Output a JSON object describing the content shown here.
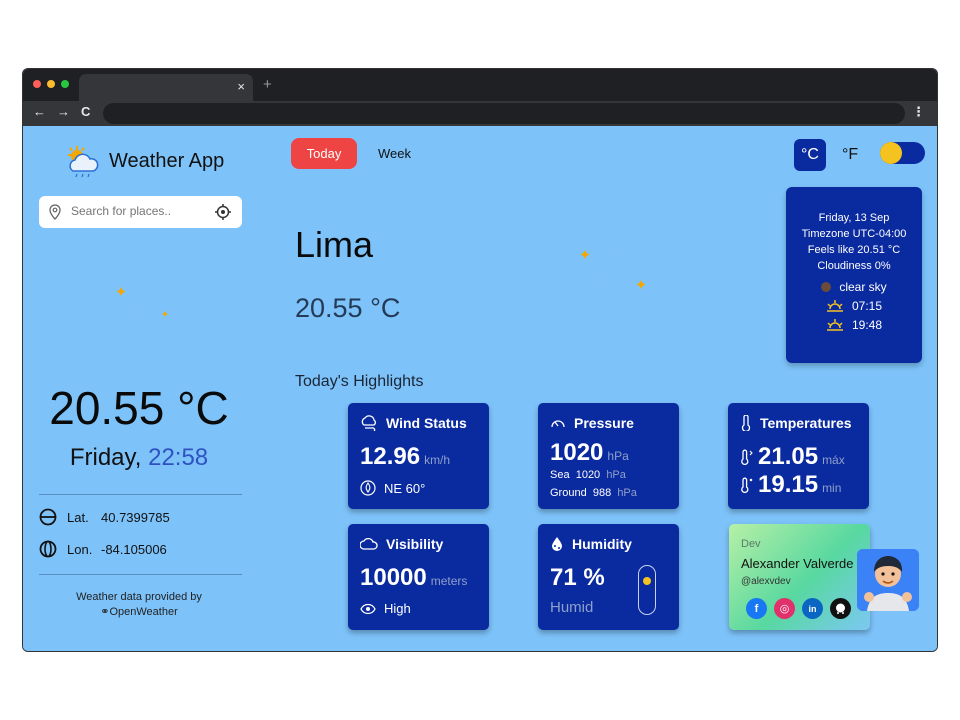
{
  "browser": {
    "tab_close": "×",
    "new_tab": "+",
    "back": "←",
    "forward": "→",
    "reload": "C",
    "menu": "⋮"
  },
  "app": {
    "title": "Weather App",
    "icon": "weather-cloud-sun-icon"
  },
  "search": {
    "placeholder": "Search for places.."
  },
  "sidebar": {
    "temperature": "20.55 °C",
    "day": "Friday,",
    "time": "22:58",
    "lat_label": "Lat.",
    "lat_value": "40.7399785",
    "lon_label": "Lon.",
    "lon_value": "-84.105006",
    "credit_line1": "Weather data provided by",
    "credit_line2": "OpenWeather"
  },
  "header": {
    "today": "Today",
    "week": "Week",
    "celsius": "°C",
    "fahrenheit": "°F",
    "theme_toggle_on": true
  },
  "main": {
    "city": "Lima",
    "temperature": "20.55 °C",
    "highlights_title": "Today's Highlights"
  },
  "info": {
    "date": "Friday, 13 Sep",
    "timezone": "Timezone UTC-04:00",
    "feels_like": "Feels like 20.51 °C",
    "cloudiness": "Cloudiness 0%",
    "condition": "clear sky",
    "sunrise": "07:15",
    "sunset": "19:48"
  },
  "cards": {
    "wind": {
      "title": "Wind Status",
      "value": "12.96",
      "unit": "km/h",
      "direction": "NE 60°"
    },
    "pressure": {
      "title": "Pressure",
      "value": "1020",
      "unit": "hPa",
      "sea_label": "Sea",
      "sea_value": "1020",
      "sea_unit": "hPa",
      "ground_label": "Ground",
      "ground_value": "988",
      "ground_unit": "hPa"
    },
    "temperatures": {
      "title": "Temperatures",
      "max": "21.05",
      "max_label": "máx",
      "min": "19.15",
      "min_label": "min"
    },
    "visibility": {
      "title": "Visibility",
      "value": "10000",
      "unit": "meters",
      "level": "High"
    },
    "humidity": {
      "title": "Humidity",
      "value": "71 %",
      "label": "Humid",
      "level_percent": 71
    }
  },
  "dev": {
    "label": "Dev",
    "name": "Alexander Valverde",
    "handle": "@alexvdev",
    "socials": [
      {
        "name": "facebook",
        "glyph": "f",
        "color": "#1877f2"
      },
      {
        "name": "instagram",
        "glyph": "◎",
        "color": "#e1306c"
      },
      {
        "name": "linkedin",
        "glyph": "in",
        "color": "#0a66c2"
      },
      {
        "name": "github",
        "glyph": "●",
        "color": "#111111"
      }
    ]
  },
  "colors": {
    "background": "#7dc3fa",
    "card": "#0a2aa0",
    "accent_red": "#ef4444",
    "moon": "#f5a700",
    "time": "#2f52c3"
  }
}
